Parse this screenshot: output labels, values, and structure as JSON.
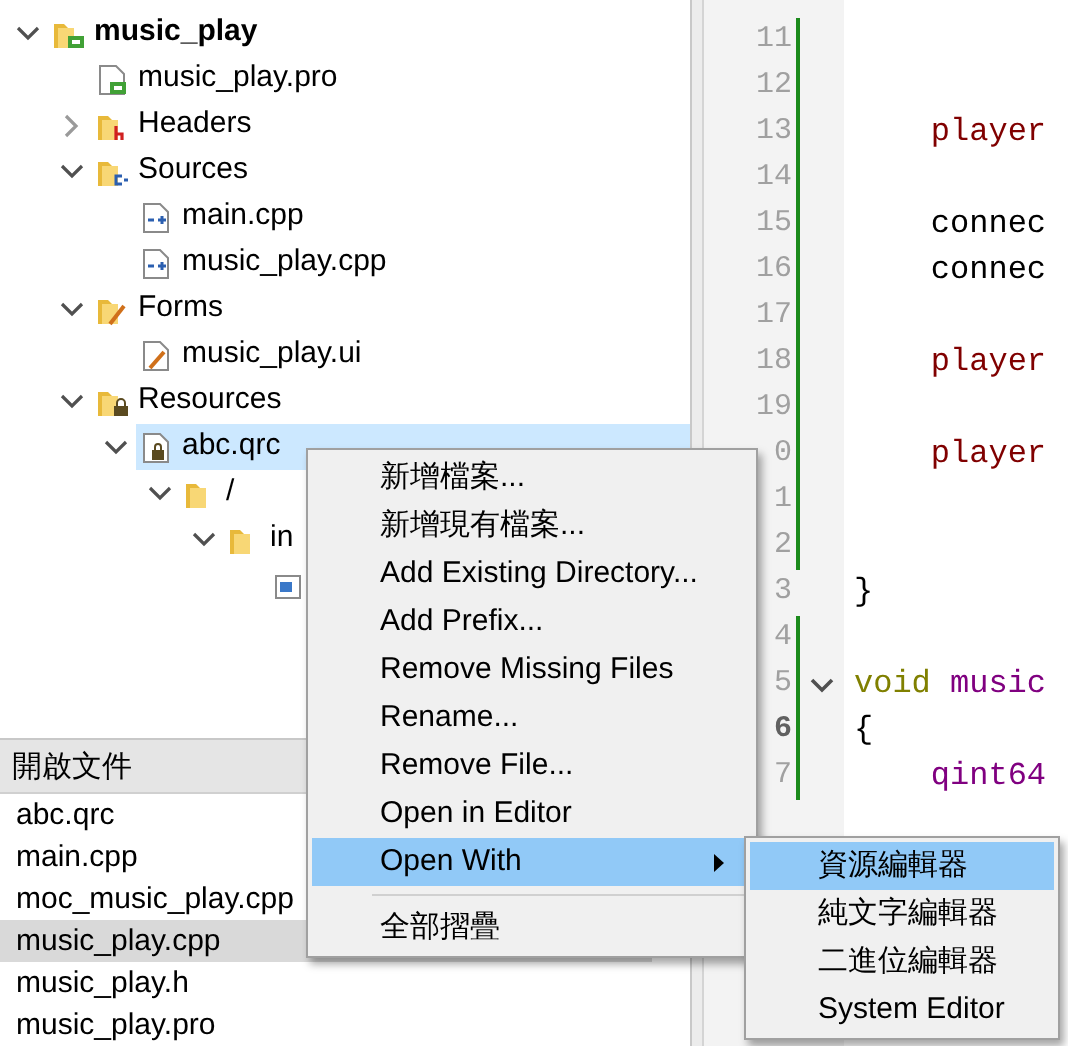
{
  "project_tree": [
    {
      "label": "music_play",
      "kind": "project",
      "expanded": true,
      "selected": false,
      "children": [
        {
          "label": "music_play.pro",
          "kind": "profile",
          "selected": false
        },
        {
          "label": "Headers",
          "kind": "headers",
          "expanded": false,
          "selected": false
        },
        {
          "label": "Sources",
          "kind": "sources",
          "expanded": true,
          "selected": false,
          "children": [
            {
              "label": "main.cpp",
              "kind": "cppfile",
              "selected": false
            },
            {
              "label": "music_play.cpp",
              "kind": "cppfile",
              "selected": false
            }
          ]
        },
        {
          "label": "Forms",
          "kind": "forms",
          "expanded": true,
          "selected": false,
          "children": [
            {
              "label": "music_play.ui",
              "kind": "uifile",
              "selected": false
            }
          ]
        },
        {
          "label": "Resources",
          "kind": "resources",
          "expanded": true,
          "selected": false,
          "children": [
            {
              "label": "abc.qrc",
              "kind": "qrcfile",
              "expanded": true,
              "selected": true,
              "children": [
                {
                  "label": "/",
                  "kind": "folder",
                  "expanded": true,
                  "selected": false,
                  "children": [
                    {
                      "label": "in",
                      "kind": "folder",
                      "expanded": true,
                      "selected": false,
                      "children": [
                        {
                          "kind": "imagefile",
                          "selected": false
                        }
                      ]
                    }
                  ]
                }
              ]
            }
          ]
        }
      ]
    }
  ],
  "open_documents": {
    "title": "開啟文件",
    "items": [
      {
        "label": "abc.qrc",
        "selected": false
      },
      {
        "label": "main.cpp",
        "selected": false
      },
      {
        "label": "moc_music_play.cpp",
        "selected": false
      },
      {
        "label": "music_play.cpp",
        "selected": true
      },
      {
        "label": "music_play.h",
        "selected": false
      },
      {
        "label": "music_play.pro",
        "selected": false
      }
    ]
  },
  "editor": {
    "lines": [
      {
        "number": "11",
        "changed": true
      },
      {
        "number": "12",
        "changed": true
      },
      {
        "number": "13",
        "changed": true,
        "indent": true,
        "tokens": [
          {
            "text": "player",
            "kind": "member"
          }
        ]
      },
      {
        "number": "14",
        "changed": true
      },
      {
        "number": "15",
        "changed": true,
        "indent": true,
        "tokens": [
          {
            "text": "connec",
            "kind": "plain"
          }
        ]
      },
      {
        "number": "16",
        "changed": true,
        "indent": true,
        "tokens": [
          {
            "text": "connec",
            "kind": "plain"
          }
        ]
      },
      {
        "number": "17",
        "changed": true
      },
      {
        "number": "18",
        "changed": true,
        "indent": true,
        "tokens": [
          {
            "text": "player",
            "kind": "member"
          }
        ]
      },
      {
        "number": "19",
        "changed": true
      },
      {
        "number": "0",
        "changed": true,
        "indent": true,
        "tokens": [
          {
            "text": "player",
            "kind": "member"
          }
        ]
      },
      {
        "number": "1",
        "changed": true
      },
      {
        "number": "2",
        "changed": true
      },
      {
        "number": "3",
        "changed": false,
        "tokens": [
          {
            "text": "}",
            "kind": "plain"
          }
        ]
      },
      {
        "number": "4",
        "changed": true
      },
      {
        "number": "5",
        "changed": true,
        "fold": true,
        "tokens": [
          {
            "text": "void",
            "kind": "keyword"
          },
          {
            "text": "music",
            "kind": "type"
          }
        ]
      },
      {
        "number": "6",
        "changed": true,
        "current": true,
        "tokens": [
          {
            "text": "{",
            "kind": "plain"
          }
        ]
      },
      {
        "number": "7",
        "changed": true,
        "indent": true,
        "tokens": [
          {
            "text": "qint64",
            "kind": "type"
          }
        ]
      }
    ]
  },
  "context_menu": {
    "items": [
      {
        "label": "新增檔案...",
        "selected": false
      },
      {
        "label": "新增現有檔案...",
        "selected": false
      },
      {
        "label": "Add Existing Directory...",
        "selected": false
      },
      {
        "label": "Add Prefix...",
        "selected": false
      },
      {
        "label": "Remove Missing Files",
        "selected": false
      },
      {
        "label": "Rename...",
        "selected": false
      },
      {
        "label": "Remove File...",
        "selected": false
      },
      {
        "label": "Open in Editor",
        "selected": false
      },
      {
        "label": "Open With",
        "selected": true,
        "submenu": true
      },
      {
        "label": "全部摺疊",
        "selected": false,
        "separator_before": true
      }
    ]
  },
  "submenu": {
    "items": [
      {
        "label": "資源編輯器",
        "selected": true
      },
      {
        "label": "純文字編輯器",
        "selected": false
      },
      {
        "label": "二進位編輯器",
        "selected": false
      },
      {
        "label": "System Editor",
        "selected": false
      }
    ]
  }
}
